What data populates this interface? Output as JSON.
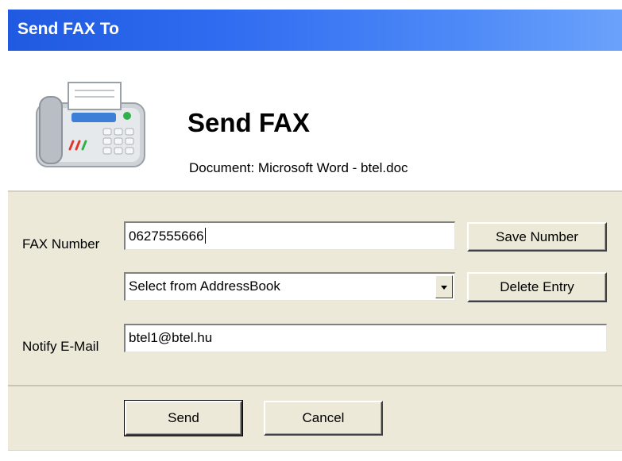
{
  "window": {
    "title": "Send FAX To"
  },
  "header": {
    "heading": "Send FAX",
    "document_line": "Document: Microsoft Word - btel.doc",
    "icon": "fax-machine-icon"
  },
  "form": {
    "fax_number_label": "FAX Number",
    "fax_number_value": "0627555666",
    "addressbook_selected": "Select from AddressBook",
    "notify_email_label": "Notify E-Mail",
    "notify_email_value": "btel1@btel.hu",
    "save_number_label": "Save Number",
    "delete_entry_label": "Delete Entry"
  },
  "actions": {
    "send_label": "Send",
    "cancel_label": "Cancel"
  },
  "colors": {
    "title_bar": "#2f6cf0",
    "dialog_face": "#ece9d8",
    "fax_led": "#2fb14a",
    "fax_buttons": "#e0362a"
  }
}
